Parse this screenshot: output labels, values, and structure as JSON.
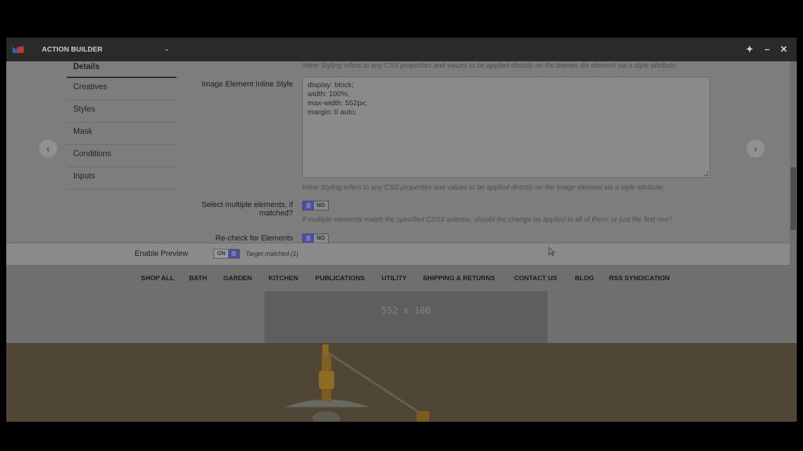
{
  "header": {
    "app_title": "ACTION BUILDER",
    "pin_icon": "pin-icon",
    "minimize_icon": "minimize-icon",
    "close_icon": "close-icon"
  },
  "sidebar": {
    "items": [
      {
        "label": "Details",
        "active": true
      },
      {
        "label": "Creatives",
        "active": false
      },
      {
        "label": "Styles",
        "active": false
      },
      {
        "label": "Mask",
        "active": false
      },
      {
        "label": "Conditions",
        "active": false
      },
      {
        "label": "Inputs",
        "active": false
      }
    ]
  },
  "form": {
    "banner_hint": "Inline Styling refers to any CSS properties and values to be applied directly on the banner div element via a style attribute.",
    "image_style_label": "Image Element Inline Style",
    "image_style_value": [
      "display: block;",
      "width: 100%;",
      "max-width: 552px;",
      "margin: 0 auto;"
    ],
    "image_style_hint": "Inline Styling refers to any CSS properties and values to be applied directly on the image element via a style attribute.",
    "select_multiple_label_1": "Select multiple elements, if",
    "select_multiple_label_2": "matched?",
    "select_multiple_toggle": "NO",
    "select_multiple_hint": "If multiple elements match the specified CSS3 selector, should the change be applied to all of them, or just the first one?",
    "recheck_label": "Re-check for Elements",
    "recheck_toggle": "NO"
  },
  "preview": {
    "label": "Enable Preview",
    "toggle": "ON",
    "status": "Target matched (1)"
  },
  "site": {
    "nav": [
      "SHOP ALL",
      "BATH",
      "GARDEN",
      "KITCHEN",
      "PUBLICATIONS",
      "UTILITY",
      "SHIPPING & RETURNS",
      "CONTACT US",
      "BLOG",
      "RSS SYNDICATION"
    ],
    "placeholder": "552 x 100"
  },
  "colors": {
    "accent": "#4b4fa0",
    "topbar": "#2a2a2a"
  }
}
